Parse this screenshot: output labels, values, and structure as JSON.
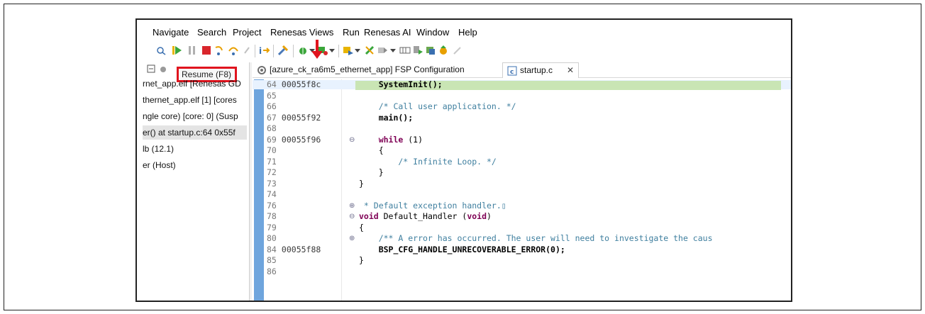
{
  "menu": {
    "items": [
      "Navigate",
      "Search",
      "Project",
      "Renesas Views",
      "Run",
      "Renesas AI",
      "Window",
      "Help"
    ]
  },
  "tooltip": {
    "text": "Resume (F8)"
  },
  "debug_panel": {
    "rows": [
      "rnet_app.elf [Renesas GD",
      "thernet_app.elf [1] [cores",
      "ngle core) [core: 0] (Susp",
      "er() at startup.c:64 0x55f",
      "lb (12.1)",
      "er (Host)"
    ]
  },
  "editor": {
    "tabs": [
      {
        "label": "[azure_ck_ra6m5_ethernet_app] FSP Configuration",
        "icon": "gear-icon"
      },
      {
        "label": "startup.c",
        "icon": "c-file-icon",
        "close": "✕"
      }
    ],
    "lines": [
      {
        "ln": "64",
        "addr": "00055f8c",
        "code": "    SystemInit();",
        "current": true
      },
      {
        "ln": "65",
        "addr": "",
        "code": ""
      },
      {
        "ln": "66",
        "addr": "",
        "code": "    /* Call user application. */",
        "comment": true
      },
      {
        "ln": "67",
        "addr": "00055f92",
        "code": "    main();"
      },
      {
        "ln": "68",
        "addr": "",
        "code": ""
      },
      {
        "ln": "69",
        "addr": "00055f96",
        "code": "    while (1)",
        "fold": "⊖"
      },
      {
        "ln": "70",
        "addr": "",
        "code": "    {"
      },
      {
        "ln": "71",
        "addr": "",
        "code": "        /* Infinite Loop. */",
        "comment": true
      },
      {
        "ln": "72",
        "addr": "",
        "code": "    }"
      },
      {
        "ln": "73",
        "addr": "",
        "code": "}"
      },
      {
        "ln": "74",
        "addr": "",
        "code": ""
      },
      {
        "ln": "76",
        "addr": "",
        "code": " * Default exception handler.▯",
        "comment": true,
        "fold": "⊕"
      },
      {
        "ln": "78",
        "addr": "",
        "code": "void Default_Handler (void)",
        "fold": "⊖"
      },
      {
        "ln": "79",
        "addr": "",
        "code": "{"
      },
      {
        "ln": "80",
        "addr": "",
        "code": "    /** A error has occurred. The user will need to investigate the caus",
        "comment": true,
        "fold": "⊕"
      },
      {
        "ln": "84",
        "addr": "00055f88",
        "code": "    BSP_CFG_HANDLE_UNRECOVERABLE_ERROR(0);"
      },
      {
        "ln": "85",
        "addr": "",
        "code": "}"
      },
      {
        "ln": "86",
        "addr": "",
        "code": ""
      }
    ]
  },
  "colors": {
    "annotation_red": "#e0141e",
    "current_line": "#c9e5b4",
    "ruler_blue": "#6fa5dd",
    "keyword": "#7f0055",
    "comment": "#3f7f9f"
  }
}
